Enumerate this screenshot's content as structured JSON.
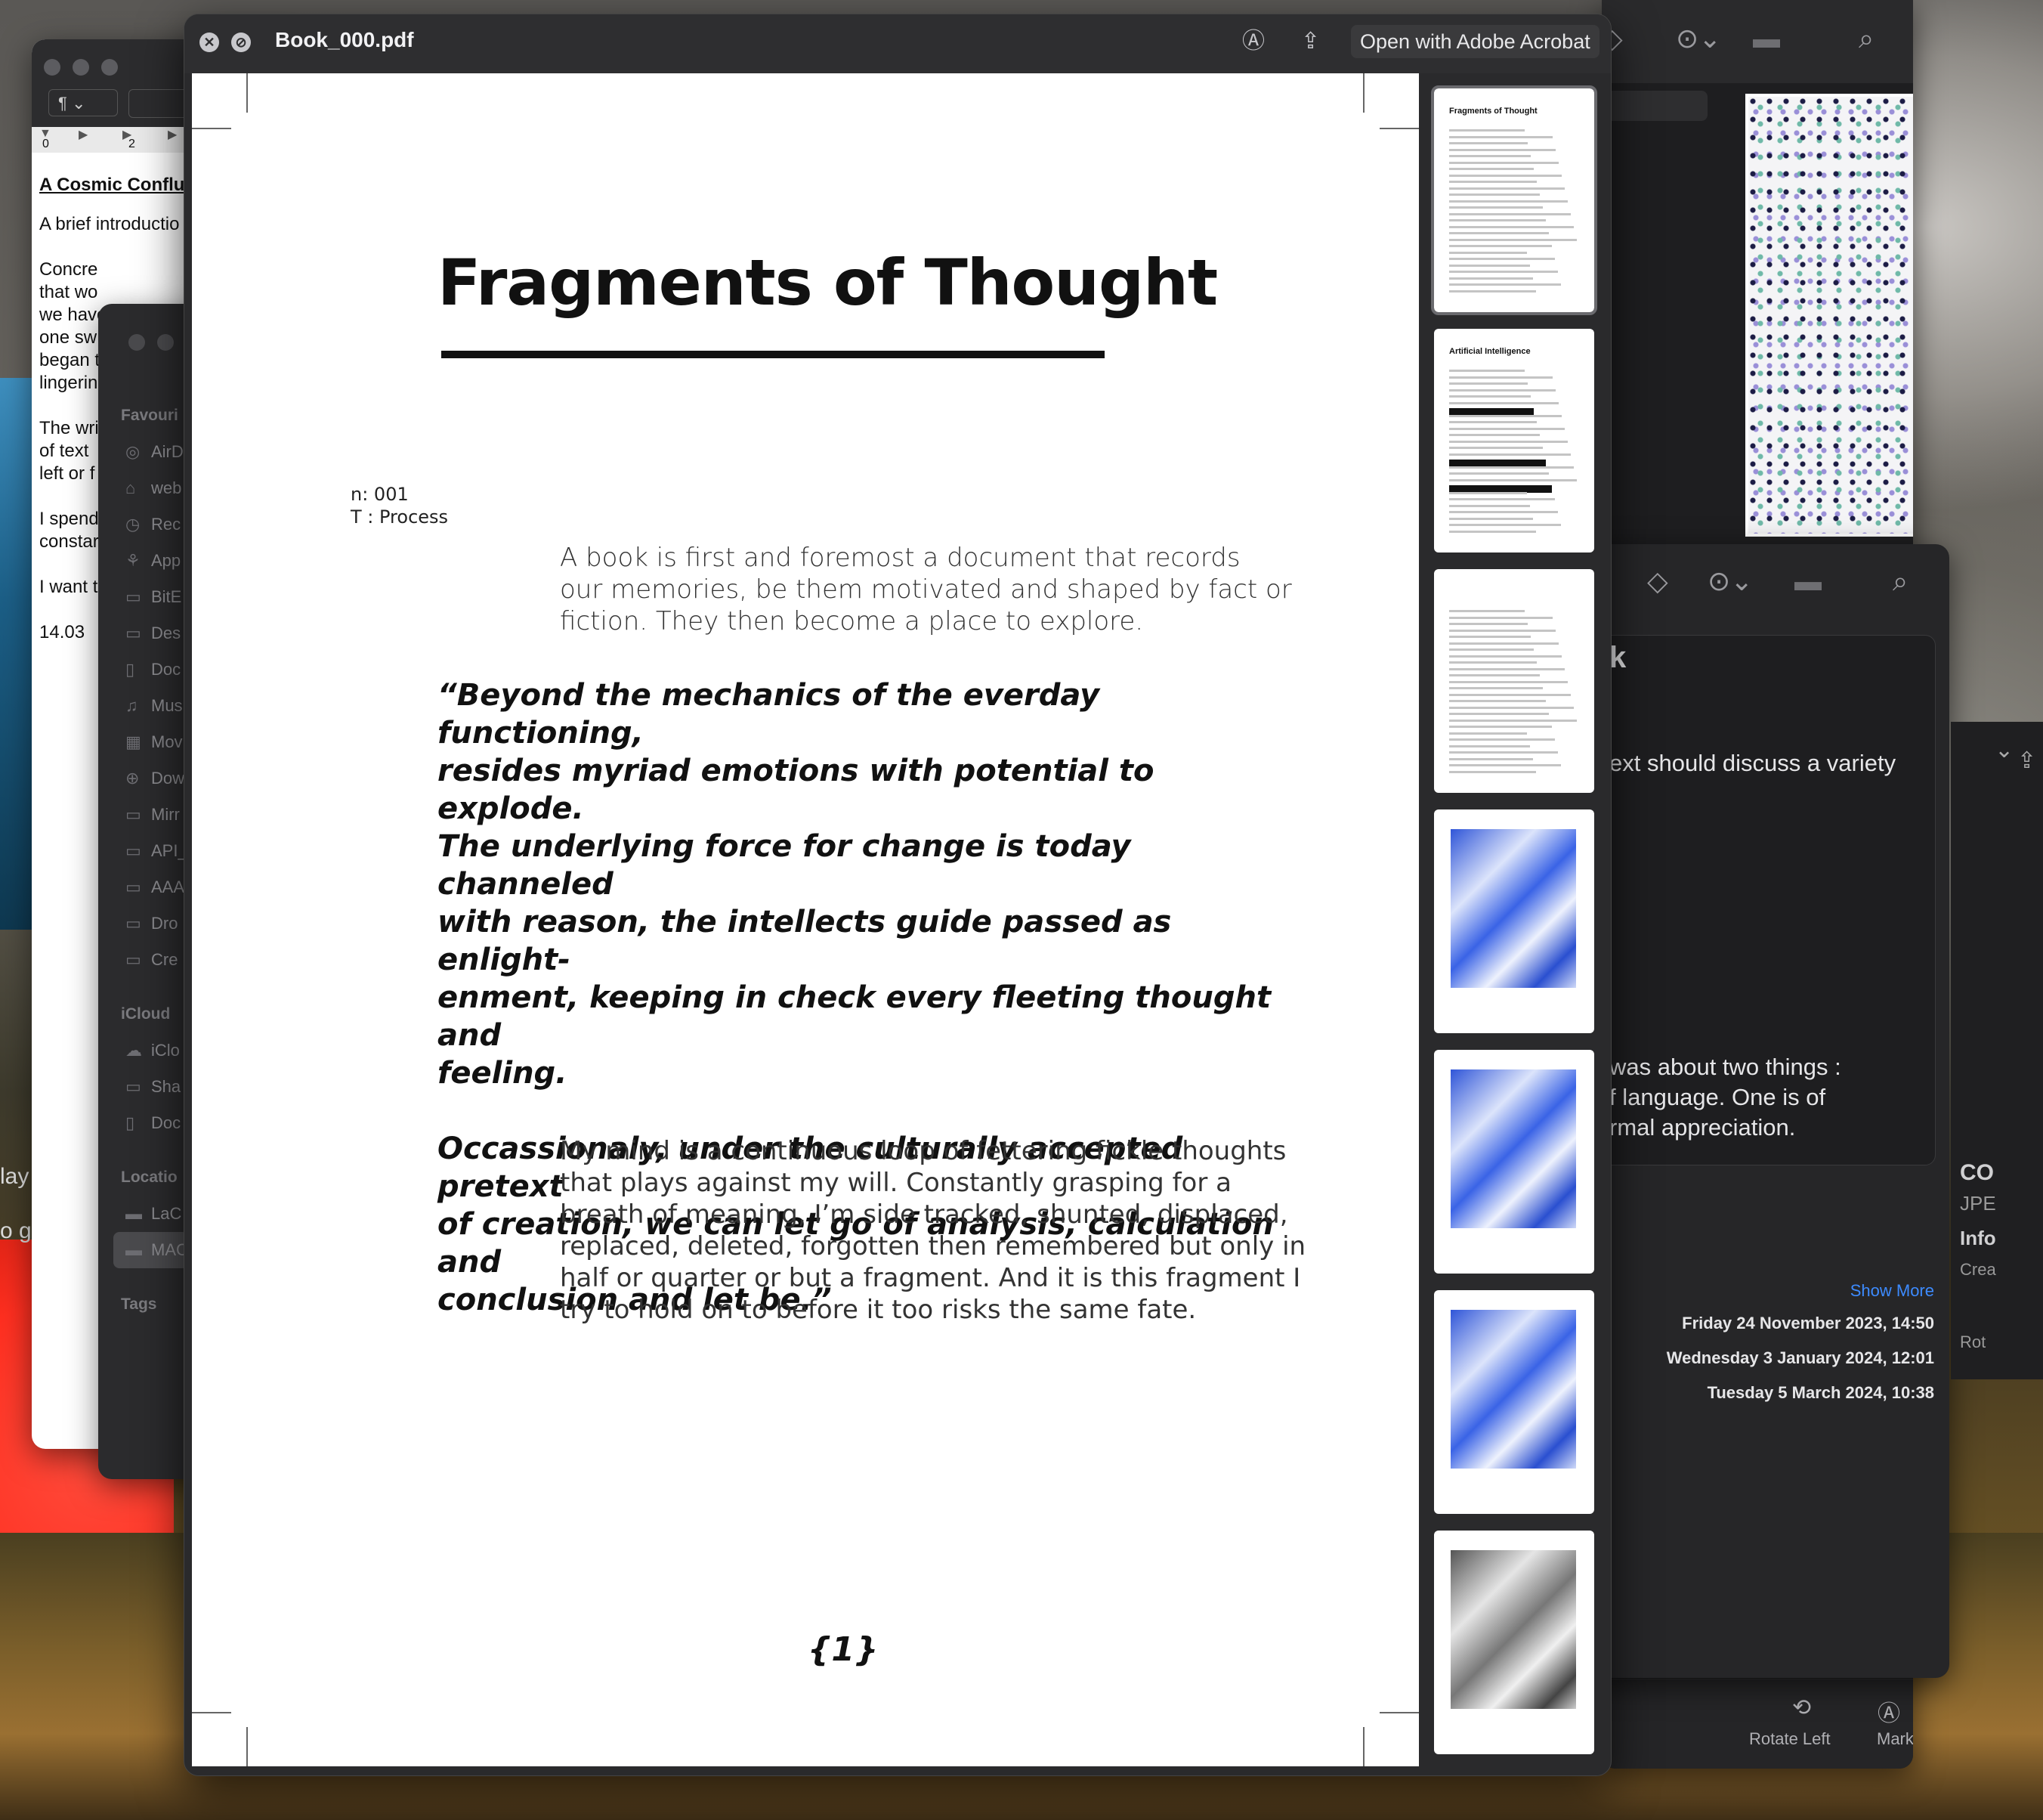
{
  "desktop": {
    "wallpaper": "misty vineyard hills"
  },
  "editor_window": {
    "paragraph_style": "¶",
    "ruler_marks": [
      "0",
      "2"
    ],
    "heading": "A Cosmic Conflue",
    "lines": [
      "A brief introductio",
      "",
      "Concre",
      "that wo",
      "we have",
      "one sw",
      "began t",
      "lingerin",
      "",
      "The wri",
      "of text",
      "left or f",
      "",
      "I spend",
      "constar",
      "",
      "I want t",
      "",
      "14.03"
    ]
  },
  "finder_sidebar": {
    "favourites_label": "Favouri",
    "favourites": [
      {
        "icon": "airdrop-icon",
        "label": "AirD"
      },
      {
        "icon": "home-icon",
        "label": "web"
      },
      {
        "icon": "recents-icon",
        "label": "Rec"
      },
      {
        "icon": "applications-icon",
        "label": "App"
      },
      {
        "icon": "folder-icon",
        "label": "BitE"
      },
      {
        "icon": "desktop-icon",
        "label": "Des"
      },
      {
        "icon": "document-icon",
        "label": "Doc"
      },
      {
        "icon": "music-icon",
        "label": "Mus"
      },
      {
        "icon": "movies-icon",
        "label": "Mov"
      },
      {
        "icon": "downloads-icon",
        "label": "Dow"
      },
      {
        "icon": "folder-icon",
        "label": "Mirr"
      },
      {
        "icon": "folder-icon",
        "label": "API_"
      },
      {
        "icon": "folder-icon",
        "label": "AAA"
      },
      {
        "icon": "folder-icon",
        "label": "Dro"
      },
      {
        "icon": "folder-icon",
        "label": "Cre"
      }
    ],
    "icloud_label": "iCloud",
    "icloud": [
      {
        "icon": "icloud-icon",
        "label": "iClo"
      },
      {
        "icon": "shared-folder-icon",
        "label": "Sha"
      },
      {
        "icon": "document-icon",
        "label": "Doc"
      }
    ],
    "locations_label": "Locatio",
    "locations": [
      {
        "icon": "disk-icon",
        "label": "LaC"
      },
      {
        "icon": "disk-icon",
        "label": "MAC"
      }
    ],
    "tags_label": "Tags"
  },
  "left_edge": {
    "text1": "lay",
    "text2": "o ge"
  },
  "pdf_window": {
    "filename": "Book_000.pdf",
    "open_with_label": "Open with Adobe Acrobat",
    "page": {
      "title": "Fragments of Thought",
      "meta_n": "n: 001",
      "meta_t": "T : Process",
      "intro": " A book is first and foremost a document that records\nour memories, be them motivated and shaped by fact or\nfiction. They then become a place to explore.",
      "quote": "“Beyond the mechanics of the everday functioning,\nresides myriad emotions with potential to explode.\nThe underlying force for change is today channeled\nwith reason, the intellects guide passed as enlight-\nenment, keeping in check every fleeting thought and\nfeeling.\n\nOccassionaly, under the culturally accepted pretext\nof creation, we can let go of analysis, calculation and\nconclusion and let be.”",
      "paragraph": "My mind is a continuous loop of fettering fickle thoughts\nthat plays against my will. Constantly grasping for a\nbreath of meaning, I’m side tracked, shunted, displaced,\nreplaced, deleted, forgotten then remembered but only in\nhalf or quarter or but a fragment. And it is this fragment I\ntry to hold on to before it too risks the same fate.",
      "page_number": "{1}"
    },
    "thumbnails": [
      {
        "title": "Fragments of Thought",
        "kind": "text",
        "selected": true
      },
      {
        "title": "Artificial Intelligence",
        "kind": "text-redacted",
        "selected": false
      },
      {
        "title": "",
        "kind": "text",
        "selected": false
      },
      {
        "title": "",
        "kind": "blue-collage",
        "selected": false
      },
      {
        "title": "",
        "kind": "blue-collage",
        "selected": false
      },
      {
        "title": "",
        "kind": "blue-collage",
        "selected": false
      },
      {
        "title": "",
        "kind": "grey-collage",
        "selected": false
      }
    ]
  },
  "info_window": {
    "heading_fragment": "k",
    "text1": "ext should discuss a variety",
    "text2_lines": [
      "was about two things :",
      "f language. One is of",
      "rmal appreciation."
    ],
    "show_more": "Show More",
    "dates": [
      "Friday 24 November 2023, 14:50",
      "Wednesday 3 January 2024, 12:01",
      "Tuesday 5 March 2024, 10:38"
    ]
  },
  "right_strip": {
    "co": "CO",
    "jpe": "JPE",
    "info": "Info",
    "cre": "Crea",
    "rot": "Rot"
  },
  "image_window": {
    "rotate_left": "Rotate Left",
    "markup": "Mark"
  },
  "colors": {
    "accent_link": "#3d8bff",
    "window_bg": "#2a2a2c",
    "page_bg": "#ffffff"
  }
}
